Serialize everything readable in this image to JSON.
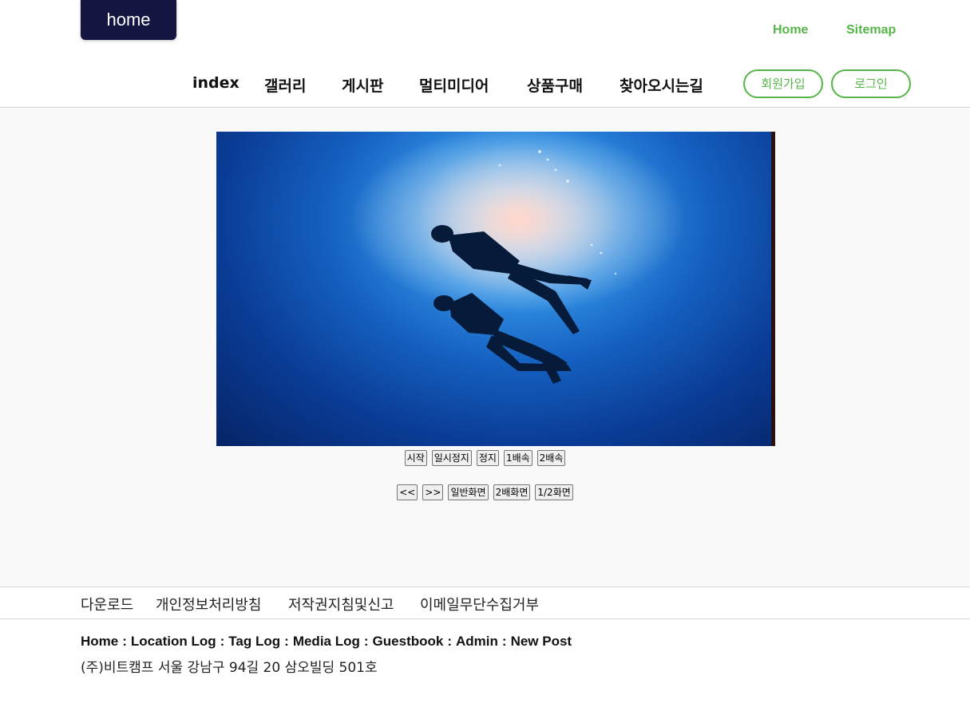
{
  "header": {
    "logo_text": "home",
    "util_links": [
      "Home",
      "Sitemap"
    ],
    "nav": [
      "index",
      "갤러리",
      "게시판",
      "멀티미디어",
      "상품구매",
      "찾아오시는길"
    ],
    "signup_label": "회원가입",
    "login_label": "로그인"
  },
  "player": {
    "controls_row1": [
      "시작",
      "일시정지",
      "정지",
      "1배속",
      "2배속"
    ],
    "controls_row2": [
      "<<",
      ">>",
      "일반화면",
      "2배화면",
      "1/2화면"
    ]
  },
  "footer": {
    "links": [
      "다운로드",
      "개인정보처리방침",
      "저작권지침및신고",
      "이메일무단수집거부"
    ],
    "breadcrumbs": [
      "Home",
      "Location Log",
      "Tag Log",
      "Media Log",
      "Guestbook",
      "Admin",
      "New Post"
    ],
    "address": "(주)비트캠프 서울 강남구 94길 20 삼오빌딩 501호"
  },
  "colors": {
    "accent": "#55b548",
    "logo_bg": "#151542",
    "main_bg": "#f9f9f9"
  }
}
